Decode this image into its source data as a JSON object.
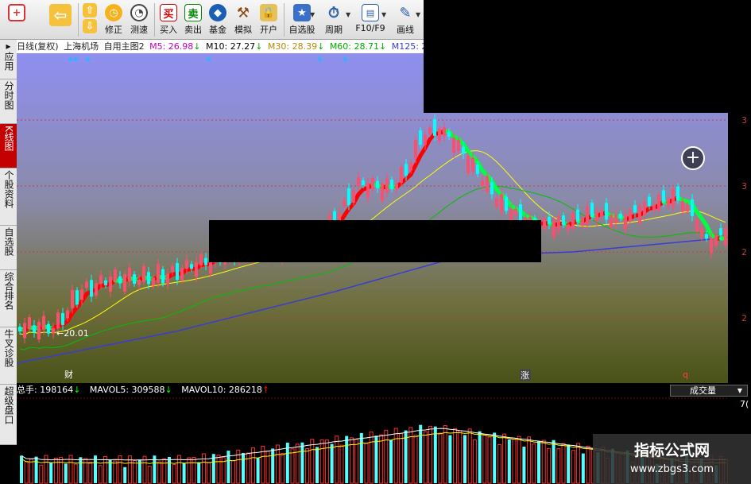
{
  "toolbar": {
    "buttons": [
      {
        "label": "",
        "icon": "window-plus-icon"
      },
      {
        "label": "",
        "icon": "back-arrow-icon"
      },
      {
        "label": "修正",
        "icon": "revise-icon"
      },
      {
        "label": "测速",
        "icon": "speed-icon"
      },
      {
        "label": "买入",
        "icon": "buy-icon",
        "glyph": "买"
      },
      {
        "label": "卖出",
        "icon": "sell-icon",
        "glyph": "卖"
      },
      {
        "label": "基金",
        "icon": "fund-icon"
      },
      {
        "label": "模拟",
        "icon": "simulate-icon"
      },
      {
        "label": "开户",
        "icon": "lock-icon"
      },
      {
        "label": "自选股",
        "icon": "star-icon"
      },
      {
        "label": "周期",
        "icon": "period-icon"
      },
      {
        "label": "F10/F9",
        "icon": "f10-icon"
      },
      {
        "label": "画线",
        "icon": "pencil-icon"
      }
    ]
  },
  "sidebar": {
    "tabs": [
      {
        "label": "应用",
        "active": false
      },
      {
        "label": "分时图",
        "active": false
      },
      {
        "label": "K线图",
        "active": true
      },
      {
        "label": "个股资料",
        "active": false
      },
      {
        "label": "自选股",
        "active": false
      },
      {
        "label": "综合排名",
        "active": false
      },
      {
        "label": "牛叉诊股",
        "active": false
      },
      {
        "label": "超级盘口",
        "active": false
      }
    ]
  },
  "mabar": {
    "period": "日线(复权)",
    "stock": "上海机场",
    "formula": "自用主图2",
    "m5": "M5: 26.98",
    "m5_dir": "↓",
    "m10": "M10: 27.27",
    "m10_dir": "↓",
    "m30": "M30: 28.39",
    "m30_dir": "↓",
    "m60": "M60: 28.71",
    "m60_dir": "↓",
    "m125": "M125: 2"
  },
  "chart": {
    "low_label": "←20.01",
    "marker_cai": "财",
    "marker_zhang": "涨",
    "marker_q": "q",
    "axis_labels": [
      "3",
      "3",
      "2",
      "2"
    ]
  },
  "volume": {
    "total": "总手: 198164",
    "total_dir": "↓",
    "mavol5": "MAVOL5: 309588",
    "mavol5_dir": "↓",
    "mavol10": "MAVOL10: 286218",
    "mavol10_dir": "↑",
    "indicator": "成交量",
    "axis_top": "7("
  },
  "watermark": {
    "title": "指标公式网",
    "url": "www.zbgs3.com"
  },
  "colors": {
    "up": "#ff4d6d",
    "down": "#00ffff",
    "ma5": "#ffffff",
    "ma10": "#ffff00",
    "ma30": "#ff00ff",
    "ma60": "#00c000",
    "ma125": "#3b3bd6",
    "trend_up": "#ff0000",
    "trend_down": "#00ff40",
    "active_tab": "#c40000"
  }
}
